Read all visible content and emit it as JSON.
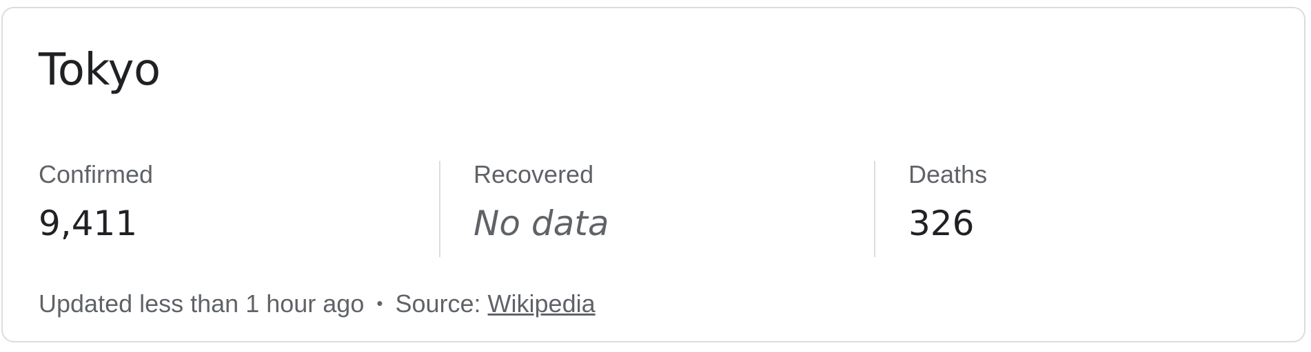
{
  "card": {
    "title": "Tokyo",
    "stats": [
      {
        "label": "Confirmed",
        "value": "9,411"
      },
      {
        "label": "Recovered",
        "value": "No data"
      },
      {
        "label": "Deaths",
        "value": "326"
      }
    ],
    "footer": {
      "updated": "Updated less than 1 hour ago",
      "separator": "•",
      "source_prefix": "Source:",
      "source_link": "Wikipedia"
    }
  },
  "colors": {
    "text_primary": "#202124",
    "text_secondary": "#5f6368",
    "border": "#dadce0"
  }
}
